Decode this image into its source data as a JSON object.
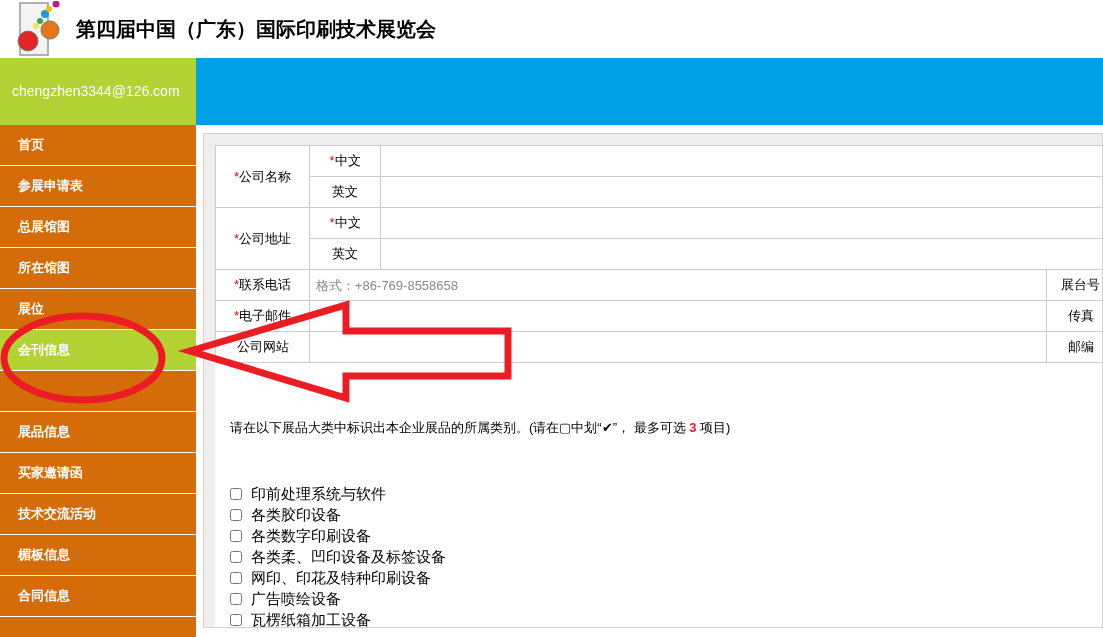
{
  "header": {
    "title": "第四届中国（广东）国际印刷技术展览会"
  },
  "user": {
    "email": "chengzhen3344@126.com"
  },
  "sidebar": {
    "items": [
      {
        "label": "首页",
        "selected": false
      },
      {
        "label": "参展申请表",
        "selected": false
      },
      {
        "label": "总展馆图",
        "selected": false
      },
      {
        "label": "所在馆图",
        "selected": false
      },
      {
        "label": "展位",
        "selected": false
      },
      {
        "label": "会刊信息",
        "selected": true
      },
      {
        "selected": false
      },
      {
        "label": "展品信息",
        "selected": false
      },
      {
        "label": "买家邀请函",
        "selected": false
      },
      {
        "label": "技术交流活动",
        "selected": false
      },
      {
        "label": "楣板信息",
        "selected": false
      },
      {
        "label": "合同信息",
        "selected": false
      }
    ]
  },
  "form": {
    "required_mark": "*",
    "rows": [
      {
        "kind": "bilingual",
        "label": "公司名称",
        "required": true,
        "parts": [
          {
            "label": "中文",
            "required": true
          },
          {
            "label": "英文",
            "required": false
          }
        ]
      },
      {
        "kind": "bilingual",
        "label": "公司地址",
        "required": true,
        "parts": [
          {
            "label": "中文",
            "required": true
          },
          {
            "label": "英文",
            "required": false
          }
        ]
      },
      {
        "kind": "split",
        "label": "联系电话",
        "required": true,
        "placeholder": "格式：+86-769-8558658",
        "side_label": "展台号"
      },
      {
        "kind": "split",
        "label": "电子邮件",
        "required": true,
        "side_label": "传真"
      },
      {
        "kind": "split",
        "label": "公司网站",
        "required": false,
        "side_label": "邮编"
      }
    ]
  },
  "categories": {
    "instruction": "请在以下展品大类中标识出本企业展品的所属类别。(请在▢中划“✔”， 最多可选 **3** 项目)",
    "items": [
      {
        "label": "印前处理系统与软件",
        "checked": false
      },
      {
        "label": "各类胶印设备",
        "checked": false
      },
      {
        "label": "各类数字印刷设备",
        "checked": false
      },
      {
        "label": "各类柔、凹印设备及标签设备",
        "checked": false
      },
      {
        "label": "网印、印花及特种印刷设备",
        "checked": false
      },
      {
        "label": "广告喷绘设备",
        "checked": false
      },
      {
        "label": "瓦楞纸箱加工设备",
        "checked": false
      }
    ]
  }
}
